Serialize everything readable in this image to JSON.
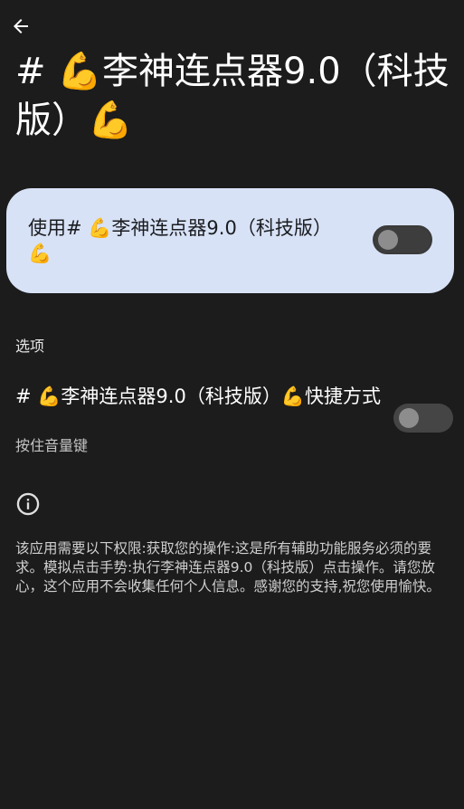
{
  "header": {
    "back_icon": "arrow-back-icon",
    "title": "# 💪李神连点器9.0（科技版）💪"
  },
  "main_switch": {
    "label": "使用# 💪李神连点器9.0（科技版）💪",
    "checked": false,
    "card_color": "#d8e2f6"
  },
  "options": {
    "header": "选项",
    "shortcut": {
      "title": "# 💪李神连点器9.0（科技版）💪快捷方式",
      "summary": "按住音量键",
      "checked": false
    }
  },
  "info": {
    "icon": "info-icon",
    "text": "该应用需要以下权限:获取您的操作:这是所有辅助功能服务必须的要求。模拟点击手势:执行李神连点器9.0（科技版）点击操作。请您放心，这个应用不会收集任何个人信息。感谢您的支持,祝您使用愉快。"
  },
  "colors": {
    "background": "#1c1c1c",
    "switch_track_off": "#454545",
    "switch_thumb_off": "#8d8d8d"
  }
}
